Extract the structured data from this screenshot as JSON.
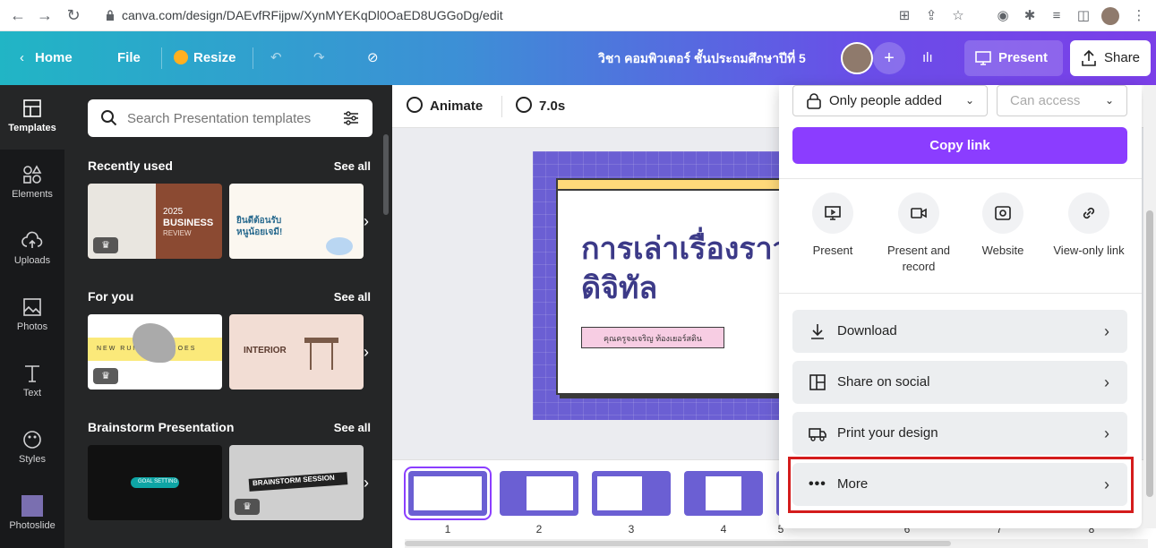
{
  "browser": {
    "url": "canva.com/design/DAEvfRFijpw/XynMYEKqDl0OaED8UGGoDg/edit"
  },
  "topbar": {
    "home": "Home",
    "file": "File",
    "resize": "Resize",
    "title": "วิชา คอมพิวเตอร์ ชั้นประถมศึกษาปีที่ 5",
    "present": "Present",
    "share": "Share"
  },
  "rail": {
    "items": [
      {
        "label": "Templates",
        "icon": "templates-icon"
      },
      {
        "label": "Elements",
        "icon": "elements-icon"
      },
      {
        "label": "Uploads",
        "icon": "uploads-icon"
      },
      {
        "label": "Photos",
        "icon": "photos-icon"
      },
      {
        "label": "Text",
        "icon": "text-icon"
      },
      {
        "label": "Styles",
        "icon": "styles-icon"
      },
      {
        "label": "Photoslide",
        "icon": "photoslide-icon"
      }
    ]
  },
  "panel": {
    "search_placeholder": "Search Presentation templates",
    "sections": [
      {
        "title": "Recently used",
        "see_all": "See all",
        "thumbs": [
          {
            "lines": [
              "2025",
              "BUSINESS",
              "REVIEW"
            ]
          },
          {
            "lines": [
              "ยินดีต้อนรับ",
              "หนูน้อยเจมี!"
            ]
          }
        ]
      },
      {
        "title": "For you",
        "see_all": "See all",
        "thumbs": [
          {
            "lines": [
              "NEW RUNNING SHOES"
            ]
          },
          {
            "lines": [
              "INTERIOR"
            ]
          }
        ]
      },
      {
        "title": "Brainstorm Presentation",
        "see_all": "See all",
        "thumbs": [
          {
            "lines": [
              "GOAL SETTING"
            ]
          },
          {
            "lines": [
              "BRAINSTORM SESSION"
            ]
          }
        ]
      }
    ]
  },
  "editor": {
    "animate": "Animate",
    "duration": "7.0s",
    "slide_title": "การเล่าเรื่องราว ดิจิทัล",
    "slide_subtitle": "คุณครูจงเจริญ ท้องเยอร์สดิน",
    "pages": [
      "1",
      "2",
      "3",
      "4",
      "5",
      "6",
      "7",
      "8"
    ]
  },
  "share_panel": {
    "access": "Only people added",
    "permission": "Can access",
    "copy_link": "Copy link",
    "options": [
      {
        "label": "Present",
        "icon": "present-icon"
      },
      {
        "label": "Present and record",
        "icon": "record-icon"
      },
      {
        "label": "Website",
        "icon": "website-icon"
      },
      {
        "label": "View-only link",
        "icon": "link-icon"
      }
    ],
    "rows": [
      {
        "label": "Download",
        "icon": "download-icon"
      },
      {
        "label": "Share on social",
        "icon": "social-icon"
      },
      {
        "label": "Print your design",
        "icon": "print-icon"
      },
      {
        "label": "More",
        "icon": "more-icon"
      }
    ]
  },
  "colors": {
    "accent": "#8b3dff",
    "highlight": "#d41c1c"
  }
}
